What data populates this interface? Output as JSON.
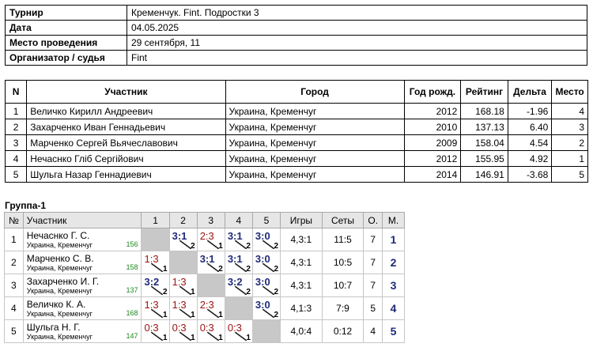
{
  "info": [
    {
      "label": "Турнир",
      "value": "Кременчук. Fint. Подростки 3"
    },
    {
      "label": "Дата",
      "value": "04.05.2025"
    },
    {
      "label": "Место проведения",
      "value": "29 сентября, 11"
    },
    {
      "label": "Организатор / судья",
      "value": "Fint"
    }
  ],
  "participants": {
    "headers": [
      "N",
      "Участник",
      "Город",
      "Год рожд.",
      "Рейтинг",
      "Дельта",
      "Место"
    ],
    "rows": [
      [
        "1",
        "Величко Кирилл Андреевич",
        "Украина, Кременчуг",
        "2012",
        "168.18",
        "-1.96",
        "4"
      ],
      [
        "2",
        "Захарченко Иван Геннадьевич",
        "Украина, Кременчуг",
        "2010",
        "137.13",
        "6.40",
        "3"
      ],
      [
        "3",
        "Марченко Сергей Вьячеславович",
        "Украина, Кременчуг",
        "2009",
        "158.04",
        "4.54",
        "2"
      ],
      [
        "4",
        "Нечаснко Гліб Сергійович",
        "Украина, Кременчуг",
        "2012",
        "155.95",
        "4.92",
        "1"
      ],
      [
        "5",
        "Шульга Назар Геннадиевич",
        "Украина, Кременчуг",
        "2014",
        "146.91",
        "-3.68",
        "5"
      ]
    ]
  },
  "group": {
    "title": "Группа-1",
    "headers": [
      "№",
      "Участник",
      "1",
      "2",
      "3",
      "4",
      "5",
      "Игры",
      "Сеты",
      "О.",
      "М."
    ],
    "rows": [
      {
        "n": "1",
        "name": "Нечаснко Г. С.",
        "city": "Украина, Кременчуг",
        "rating": "156",
        "results": [
          null,
          {
            "s": "3:1",
            "t": "2",
            "w": true
          },
          {
            "s": "2:3",
            "t": "1",
            "w": false
          },
          {
            "s": "3:1",
            "t": "2",
            "w": true
          },
          {
            "s": "3:0",
            "t": "2",
            "w": true
          }
        ],
        "games": "4,3:1",
        "sets": "11:5",
        "points": "7",
        "place": "1"
      },
      {
        "n": "2",
        "name": "Марченко С. В.",
        "city": "Украина, Кременчуг",
        "rating": "158",
        "results": [
          {
            "s": "1:3",
            "t": "1",
            "w": false
          },
          null,
          {
            "s": "3:1",
            "t": "2",
            "w": true
          },
          {
            "s": "3:1",
            "t": "2",
            "w": true
          },
          {
            "s": "3:0",
            "t": "2",
            "w": true
          }
        ],
        "games": "4,3:1",
        "sets": "10:5",
        "points": "7",
        "place": "2"
      },
      {
        "n": "3",
        "name": "Захарченко И. Г.",
        "city": "Украина, Кременчуг",
        "rating": "137",
        "results": [
          {
            "s": "3:2",
            "t": "2",
            "w": true
          },
          {
            "s": "1:3",
            "t": "1",
            "w": false
          },
          null,
          {
            "s": "3:2",
            "t": "2",
            "w": true
          },
          {
            "s": "3:0",
            "t": "2",
            "w": true
          }
        ],
        "games": "4,3:1",
        "sets": "10:7",
        "points": "7",
        "place": "3"
      },
      {
        "n": "4",
        "name": "Величко К. А.",
        "city": "Украина, Кременчуг",
        "rating": "168",
        "results": [
          {
            "s": "1:3",
            "t": "1",
            "w": false
          },
          {
            "s": "1:3",
            "t": "1",
            "w": false
          },
          {
            "s": "2:3",
            "t": "1",
            "w": false
          },
          null,
          {
            "s": "3:0",
            "t": "2",
            "w": true
          }
        ],
        "games": "4,1:3",
        "sets": "7:9",
        "points": "5",
        "place": "4"
      },
      {
        "n": "5",
        "name": "Шульга Н. Г.",
        "city": "Украина, Кременчуг",
        "rating": "147",
        "results": [
          {
            "s": "0:3",
            "t": "1",
            "w": false
          },
          {
            "s": "0:3",
            "t": "1",
            "w": false
          },
          {
            "s": "0:3",
            "t": "1",
            "w": false
          },
          {
            "s": "0:3",
            "t": "1",
            "w": false
          },
          null
        ],
        "games": "4,0:4",
        "sets": "0:12",
        "points": "4",
        "place": "5"
      }
    ]
  },
  "colors": {
    "win": "#1f2a78",
    "loss": "#9b1111",
    "rating": "#1a8a1a",
    "header_bg": "#e6e6e6",
    "diagonal": "#c8c8c8"
  }
}
